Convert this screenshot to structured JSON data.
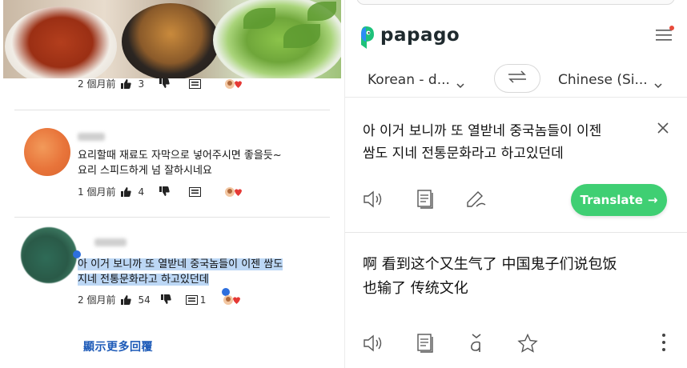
{
  "youtube": {
    "comment_top": {
      "time": "2 個月前",
      "likes": "3"
    },
    "comment_1": {
      "text_line1": "요리할때  재료도 자막으로 넣어주시면 좋을듯~",
      "text_line2": "요리 스피드하게 넘 잘하시네요",
      "time": "1 個月前",
      "likes": "4"
    },
    "comment_2": {
      "text_line1": "아 이거 보니까 또 열받네 중국놈들이 이젠 쌈도",
      "text_line2": "지네 전통문화라고 하고있던데",
      "time": "2 個月前",
      "likes": "54",
      "replies": "1"
    },
    "show_more_replies": "顯示更多回覆"
  },
  "papago": {
    "app_name": "papago",
    "source_language": "Korean - d...",
    "target_language": "Chinese (Si...",
    "source_text_line1": "아 이거 보니까 또 열받네 중국놈들이 이젠",
    "source_text_line2": "쌈도 지네 전통문화라고 하고있던데",
    "translate_button": "Translate",
    "translated_text_line1": "啊 看到这个又生气了 中国鬼子们说包饭",
    "translated_text_line2": "也输了 传统文化",
    "accent_color": "#3fcf73",
    "icons": [
      "speaker-icon",
      "copy-icon",
      "handwriting-icon",
      "pinyin-icon",
      "star-icon",
      "more-vertical-icon",
      "swap-icon",
      "menu-icon",
      "close-icon",
      "chevron-down-icon"
    ]
  }
}
